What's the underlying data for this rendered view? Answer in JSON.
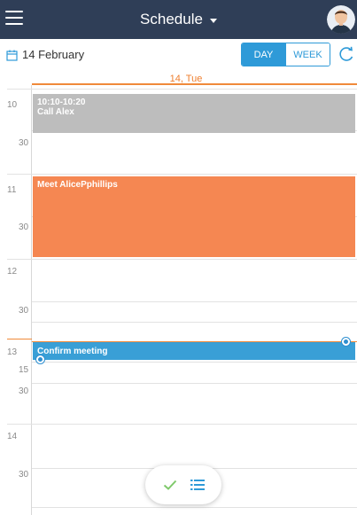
{
  "header": {
    "title": "Schedule",
    "menu_icon": "hamburger-menu-icon",
    "avatar": "user-avatar",
    "bar_color": "#2f3e57"
  },
  "subheader": {
    "date": "14 February",
    "view_day": "DAY",
    "view_week": "WEEK",
    "active_view": "DAY",
    "accent_color": "#2e9ad8"
  },
  "day_column": {
    "header": "14, Tue",
    "accent_color": "#ef7f2f"
  },
  "time_labels": {
    "h10": "10",
    "h10_30": "30",
    "h11": "11",
    "h11_30": "30",
    "h12": "12",
    "h12_30": "30",
    "h13": "13",
    "h13_15": "15",
    "h13_30": "30",
    "h14": "14",
    "h14_30": "30"
  },
  "events": [
    {
      "time": "10:10-10:20",
      "title": "Call Alex",
      "color": "#bdbdbd"
    },
    {
      "title": "Meet AlicePphillips",
      "color": "#f58752"
    },
    {
      "title": "Confirm meeting",
      "color": "#399fd6",
      "selected": true
    }
  ],
  "fab": {
    "check_icon": "check-icon",
    "list_icon": "list-icon"
  }
}
